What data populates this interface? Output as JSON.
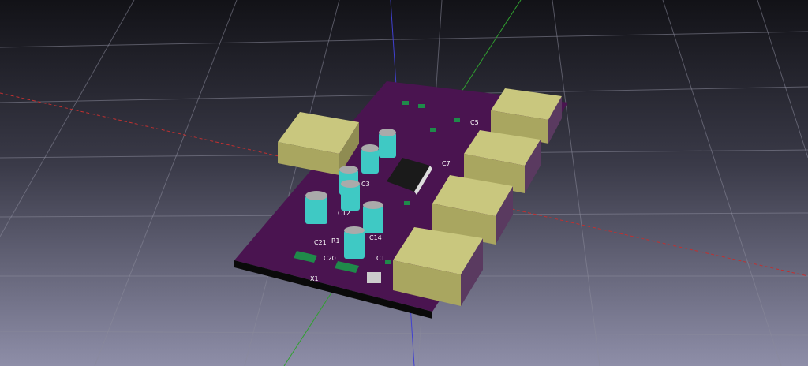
{
  "scene": {
    "title": "PCB 3D view",
    "colors": {
      "board": "#4a1450",
      "connector_top": "#c9c77e",
      "connector_side": "#a9a660",
      "capacitor": "#3fc9c4",
      "pad": "#1f8a4a",
      "axis_x": "#c03030",
      "axis_y": "#30a030",
      "axis_z": "#3030c0"
    },
    "designators": [
      "C12",
      "C20",
      "C21",
      "R1",
      "X1",
      "C3",
      "C14",
      "C7",
      "C1",
      "C5"
    ]
  }
}
